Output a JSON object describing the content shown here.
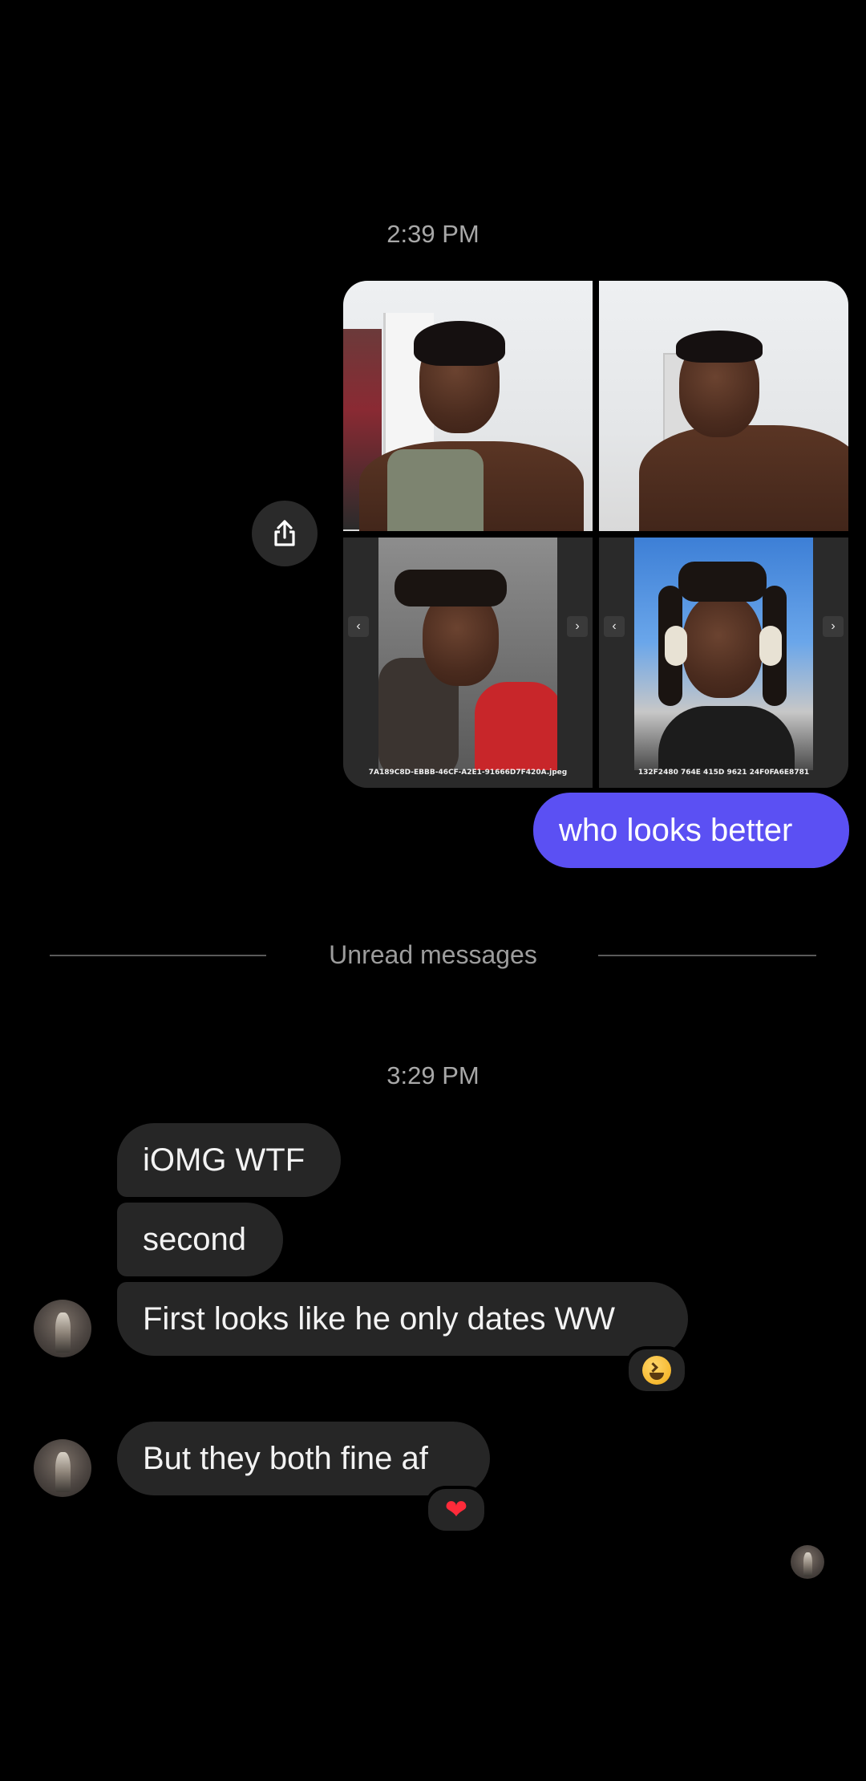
{
  "conversation": {
    "timestamp_1": "2:39 PM",
    "timestamp_2": "3:29 PM",
    "unread_divider": "Unread messages"
  },
  "shared_photos": [
    {
      "kind": "selfie"
    },
    {
      "kind": "selfie"
    },
    {
      "kind": "screenshot",
      "filename": "7A189C8D-EBBB-46CF-A2E1-91666D7F420A.jpeg"
    },
    {
      "kind": "screenshot",
      "filename": "132F2480 764E 415D 9621 24F0FA6E8781"
    }
  ],
  "outgoing_message": "who looks better",
  "incoming_messages": [
    {
      "text": "iOMG WTF"
    },
    {
      "text": "second"
    },
    {
      "text": "First looks like he only dates WW",
      "reaction": "laughing-emoji"
    },
    {
      "text": "But they both fine af",
      "reaction": "red-heart-emoji"
    }
  ],
  "colors": {
    "background": "#000000",
    "outgoing_bubble": "#5b50f3",
    "incoming_bubble": "#262626",
    "timestamp_text": "#a8a8a8"
  },
  "icons": {
    "share": "share-icon",
    "heart": "❤"
  }
}
